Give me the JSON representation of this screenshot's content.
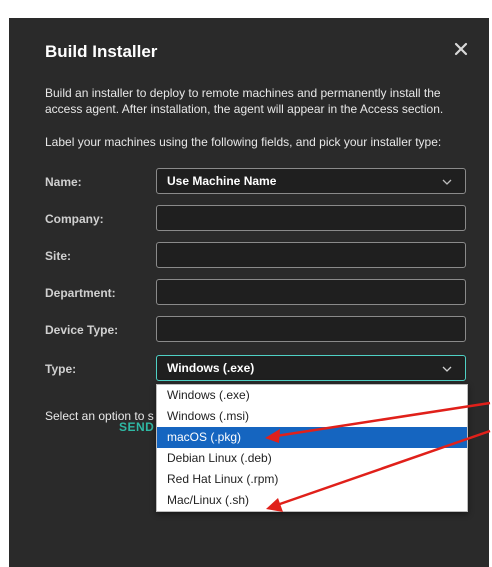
{
  "dialog": {
    "title": "Build Installer",
    "description": "Build an installer to deploy to remote machines and permanently install the access agent. After installation, the agent will appear in the Access section.",
    "instructions": "Label your machines using the following fields, and pick your installer type:",
    "close_icon": "close-icon"
  },
  "form": {
    "name_label": "Name:",
    "name_value": "Use Machine Name",
    "company_label": "Company:",
    "company_value": "",
    "site_label": "Site:",
    "site_value": "",
    "department_label": "Department:",
    "department_value": "",
    "device_type_label": "Device Type:",
    "device_type_value": "",
    "type_label": "Type:",
    "type_value": "Windows (.exe)"
  },
  "footer": {
    "partial_text": "Select an option to s",
    "send_label": "SEND"
  },
  "dropdown": {
    "options": [
      "Windows (.exe)",
      "Windows (.msi)",
      "macOS (.pkg)",
      "Debian Linux (.deb)",
      "Red Hat Linux (.rpm)",
      "Mac/Linux (.sh)"
    ],
    "highlighted": "macOS (.pkg)"
  },
  "colors": {
    "dialog_bg": "#2a2a2a",
    "accent": "#4fd1c5",
    "send": "#2fb9a4",
    "highlight": "#1565c0",
    "annotation_arrow": "#e0201a"
  }
}
